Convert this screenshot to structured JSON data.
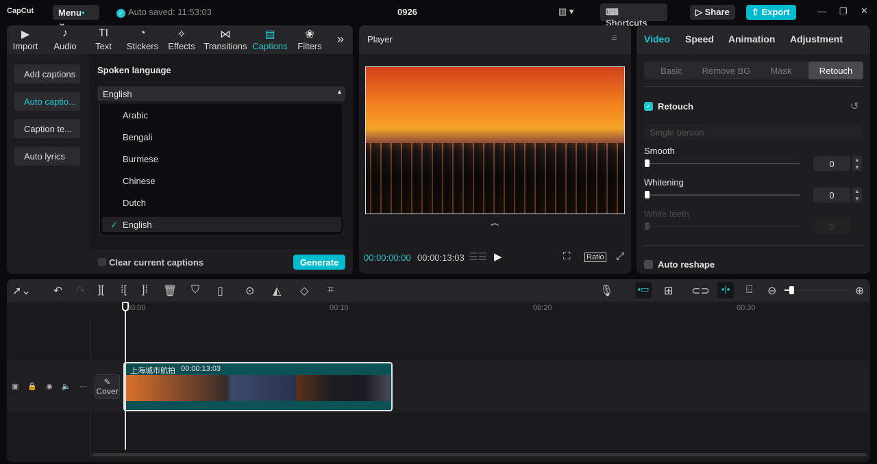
{
  "app": {
    "logo": "CapCut",
    "menu": "Menu",
    "autosaved": "Auto saved: 11:53:03",
    "project": "0926",
    "shortcuts": "Shortcuts",
    "share": "Share",
    "export": "Export"
  },
  "tabs": [
    {
      "label": "Import",
      "icon": "▶"
    },
    {
      "label": "Audio",
      "icon": "♪"
    },
    {
      "label": "Text",
      "icon": "TI"
    },
    {
      "label": "Stickers",
      "icon": "◔"
    },
    {
      "label": "Effects",
      "icon": "✧"
    },
    {
      "label": "Transitions",
      "icon": "⋈"
    },
    {
      "label": "Captions",
      "icon": "▤"
    },
    {
      "label": "Filters",
      "icon": "❀"
    }
  ],
  "caption_menu": [
    "Add captions",
    "Auto captio...",
    "Caption te...",
    "Auto lyrics"
  ],
  "spoken": {
    "label": "Spoken language",
    "value": "English",
    "options": [
      "Arabic",
      "Bengali",
      "Burmese",
      "Chinese",
      "Dutch",
      "English"
    ]
  },
  "clear_label": "Clear current captions",
  "generate": "Generate",
  "player": {
    "title": "Player",
    "current": "00:00:00:00",
    "total": "00:00:13:03",
    "ratio": "Ratio"
  },
  "right": {
    "tabs": [
      "Video",
      "Speed",
      "Animation",
      "Adjustment"
    ],
    "subtabs": [
      "Basic",
      "Remove BG",
      "Mask",
      "Retouch"
    ],
    "retouch": "Retouch",
    "mode": "Single person",
    "smooth": "Smooth",
    "smooth_val": "0",
    "whitening": "Whitening",
    "whitening_val": "0",
    "teeth": "White teeth",
    "teeth_val": "0",
    "reshape": "Auto reshape"
  },
  "timeline": {
    "ticks": [
      "00:00",
      "00:10",
      "00:20",
      "00:30"
    ],
    "clip_name": "上海城市航拍",
    "clip_dur": "00:00:13:03",
    "cover": "Cover"
  },
  "colors": {
    "accent": "#20c5d0",
    "clip": "#0b5257"
  }
}
